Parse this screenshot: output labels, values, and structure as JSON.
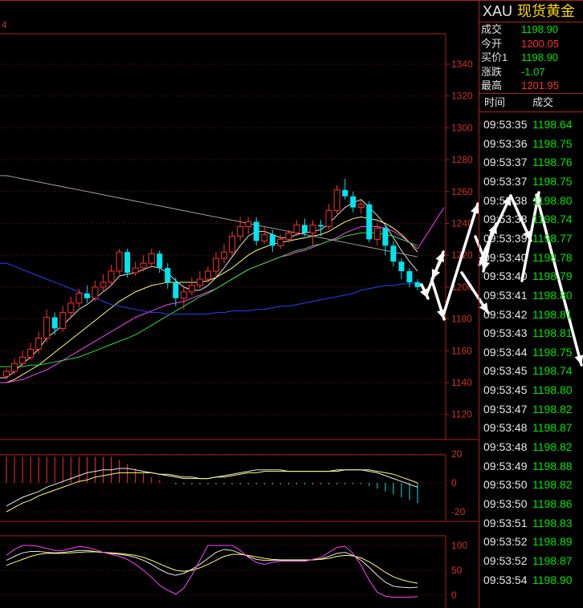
{
  "header": {
    "corner_label": "4"
  },
  "symbol": {
    "code": "XAU",
    "name": "现货黄金"
  },
  "quote": [
    {
      "label": "成交",
      "value": "1198.90",
      "color": "#00e600"
    },
    {
      "label": "今开",
      "value": "1200.05",
      "color": "#ff3030"
    },
    {
      "label": "买价1",
      "value": "1198.90",
      "color": "#00e600"
    },
    {
      "label": "涨跌",
      "value": "-1.07",
      "color": "#00e600"
    },
    {
      "label": "最高",
      "value": "1201.95",
      "color": "#ff3030"
    }
  ],
  "ticks_header": {
    "time": "时间",
    "price": "成交"
  },
  "ticks": [
    {
      "time": "09:53:35",
      "price": "1198.64"
    },
    {
      "time": "09:53:36",
      "price": "1198.75"
    },
    {
      "time": "09:53:37",
      "price": "1198.76"
    },
    {
      "time": "09:53:37",
      "price": "1198.75"
    },
    {
      "time": "09:53:38",
      "price": "1198.80"
    },
    {
      "time": "09:53:38",
      "price": "1198.74"
    },
    {
      "time": "09:53:39",
      "price": "1198.77"
    },
    {
      "time": "09:53:40",
      "price": "1198.78"
    },
    {
      "time": "09:53:40",
      "price": "1198.79"
    },
    {
      "time": "09:53:41",
      "price": "1198.80"
    },
    {
      "time": "09:53:42",
      "price": "1198.81"
    },
    {
      "time": "09:53:43",
      "price": "1198.81"
    },
    {
      "time": "09:53:44",
      "price": "1198.75"
    },
    {
      "time": "09:53:45",
      "price": "1198.74"
    },
    {
      "time": "09:53:45",
      "price": "1198.80"
    },
    {
      "time": "09:53:47",
      "price": "1198.82"
    },
    {
      "time": "09:53:48",
      "price": "1198.87"
    },
    {
      "time": "09:53:48",
      "price": "1198.82"
    },
    {
      "time": "09:53:49",
      "price": "1198.88"
    },
    {
      "time": "09:53:50",
      "price": "1198.82"
    },
    {
      "time": "09:53:50",
      "price": "1198.86"
    },
    {
      "time": "09:53:51",
      "price": "1198.83"
    },
    {
      "time": "09:53:52",
      "price": "1198.89"
    },
    {
      "time": "09:53:52",
      "price": "1198.87"
    },
    {
      "time": "09:53:54",
      "price": "1198.90"
    }
  ],
  "main_axis": {
    "ticks": [
      "1340",
      "1320",
      "1300",
      "1280",
      "1260",
      "1240",
      "1220",
      "1200",
      "1180",
      "1160",
      "1140",
      "1120"
    ],
    "min": 1110,
    "max": 1350
  },
  "macd_axis": {
    "ticks": [
      "20",
      "0",
      "-20"
    ]
  },
  "kdj_axis": {
    "ticks": [
      "100",
      "50",
      "0"
    ]
  },
  "chart_data": {
    "type": "candlestick",
    "ylim": [
      1110,
      1350
    ],
    "colors": {
      "up": "#ff3030",
      "down": "#00e5ee",
      "grid": "#7a1010"
    },
    "candles": [
      {
        "o": 1144,
        "c": 1147,
        "h": 1149,
        "l": 1142
      },
      {
        "o": 1147,
        "c": 1152,
        "h": 1155,
        "l": 1145
      },
      {
        "o": 1152,
        "c": 1156,
        "h": 1160,
        "l": 1150
      },
      {
        "o": 1156,
        "c": 1161,
        "h": 1165,
        "l": 1154
      },
      {
        "o": 1161,
        "c": 1168,
        "h": 1172,
        "l": 1158
      },
      {
        "o": 1168,
        "c": 1181,
        "h": 1186,
        "l": 1165
      },
      {
        "o": 1181,
        "c": 1174,
        "h": 1184,
        "l": 1170
      },
      {
        "o": 1174,
        "c": 1184,
        "h": 1188,
        "l": 1172
      },
      {
        "o": 1184,
        "c": 1190,
        "h": 1194,
        "l": 1181
      },
      {
        "o": 1190,
        "c": 1196,
        "h": 1199,
        "l": 1187
      },
      {
        "o": 1196,
        "c": 1193,
        "h": 1201,
        "l": 1190
      },
      {
        "o": 1193,
        "c": 1200,
        "h": 1204,
        "l": 1191
      },
      {
        "o": 1200,
        "c": 1203,
        "h": 1208,
        "l": 1197
      },
      {
        "o": 1203,
        "c": 1210,
        "h": 1214,
        "l": 1201
      },
      {
        "o": 1210,
        "c": 1222,
        "h": 1224,
        "l": 1208
      },
      {
        "o": 1222,
        "c": 1209,
        "h": 1224,
        "l": 1206
      },
      {
        "o": 1209,
        "c": 1212,
        "h": 1216,
        "l": 1207
      },
      {
        "o": 1212,
        "c": 1215,
        "h": 1220,
        "l": 1210
      },
      {
        "o": 1215,
        "c": 1221,
        "h": 1224,
        "l": 1212
      },
      {
        "o": 1221,
        "c": 1212,
        "h": 1223,
        "l": 1209
      },
      {
        "o": 1212,
        "c": 1203,
        "h": 1215,
        "l": 1199
      },
      {
        "o": 1203,
        "c": 1193,
        "h": 1206,
        "l": 1188
      },
      {
        "o": 1193,
        "c": 1197,
        "h": 1201,
        "l": 1186
      },
      {
        "o": 1197,
        "c": 1201,
        "h": 1206,
        "l": 1195
      },
      {
        "o": 1201,
        "c": 1205,
        "h": 1210,
        "l": 1199
      },
      {
        "o": 1205,
        "c": 1210,
        "h": 1213,
        "l": 1203
      },
      {
        "o": 1210,
        "c": 1218,
        "h": 1222,
        "l": 1207
      },
      {
        "o": 1218,
        "c": 1222,
        "h": 1227,
        "l": 1215
      },
      {
        "o": 1222,
        "c": 1232,
        "h": 1235,
        "l": 1220
      },
      {
        "o": 1232,
        "c": 1238,
        "h": 1244,
        "l": 1229
      },
      {
        "o": 1238,
        "c": 1241,
        "h": 1244,
        "l": 1233
      },
      {
        "o": 1241,
        "c": 1229,
        "h": 1244,
        "l": 1226
      },
      {
        "o": 1229,
        "c": 1233,
        "h": 1238,
        "l": 1227
      },
      {
        "o": 1233,
        "c": 1226,
        "h": 1236,
        "l": 1222
      },
      {
        "o": 1226,
        "c": 1230,
        "h": 1233,
        "l": 1224
      },
      {
        "o": 1230,
        "c": 1234,
        "h": 1236,
        "l": 1228
      },
      {
        "o": 1234,
        "c": 1239,
        "h": 1242,
        "l": 1232
      },
      {
        "o": 1239,
        "c": 1234,
        "h": 1243,
        "l": 1232
      },
      {
        "o": 1234,
        "c": 1239,
        "h": 1242,
        "l": 1226
      },
      {
        "o": 1239,
        "c": 1238,
        "h": 1242,
        "l": 1232
      },
      {
        "o": 1238,
        "c": 1248,
        "h": 1252,
        "l": 1236
      },
      {
        "o": 1248,
        "c": 1261,
        "h": 1264,
        "l": 1246
      },
      {
        "o": 1261,
        "c": 1257,
        "h": 1268,
        "l": 1255
      },
      {
        "o": 1257,
        "c": 1250,
        "h": 1260,
        "l": 1247
      },
      {
        "o": 1250,
        "c": 1252,
        "h": 1255,
        "l": 1246
      },
      {
        "o": 1252,
        "c": 1230,
        "h": 1254,
        "l": 1228
      },
      {
        "o": 1230,
        "c": 1237,
        "h": 1240,
        "l": 1226
      },
      {
        "o": 1237,
        "c": 1226,
        "h": 1239,
        "l": 1220
      },
      {
        "o": 1226,
        "c": 1216,
        "h": 1229,
        "l": 1213
      },
      {
        "o": 1216,
        "c": 1210,
        "h": 1218,
        "l": 1205
      },
      {
        "o": 1210,
        "c": 1203,
        "h": 1212,
        "l": 1200
      },
      {
        "o": 1203,
        "c": 1200,
        "h": 1205,
        "l": 1198
      }
    ],
    "ma_lines": [
      {
        "color": "#e0e0e0",
        "values": [
          1143,
          1147,
          1152,
          1156,
          1161,
          1168,
          1172,
          1176,
          1181,
          1186,
          1189,
          1193,
          1197,
          1201,
          1207,
          1208,
          1209,
          1211,
          1213,
          1212,
          1209,
          1204,
          1200,
          1198,
          1198,
          1201,
          1206,
          1212,
          1219,
          1226,
          1232,
          1235,
          1235,
          1233,
          1231,
          1231,
          1233,
          1234,
          1235,
          1236,
          1240,
          1245,
          1250,
          1253,
          1255,
          1250,
          1245,
          1239,
          1231,
          1223,
          1216,
          1210
        ]
      },
      {
        "color": "#ffff66",
        "values": [
          1140,
          1142,
          1145,
          1148,
          1151,
          1155,
          1159,
          1163,
          1167,
          1171,
          1175,
          1179,
          1183,
          1187,
          1191,
          1194,
          1197,
          1199,
          1201,
          1202,
          1203,
          1203,
          1203,
          1203,
          1203,
          1204,
          1206,
          1209,
          1212,
          1216,
          1220,
          1223,
          1225,
          1227,
          1228,
          1229,
          1230,
          1231,
          1232,
          1233,
          1235,
          1238,
          1241,
          1243,
          1244,
          1243,
          1242,
          1240,
          1237,
          1233,
          1228,
          1222
        ]
      },
      {
        "color": "#ff44ff",
        "values": [
          1140,
          1141,
          1142,
          1144,
          1146,
          1148,
          1151,
          1154,
          1157,
          1160,
          1163,
          1166,
          1169,
          1172,
          1175,
          1178,
          1181,
          1183,
          1185,
          1187,
          1189,
          1190,
          1191,
          1193,
          1195,
          1197,
          1199,
          1202,
          1205,
          1208,
          1211,
          1213,
          1215,
          1217,
          1219,
          1220,
          1222,
          1223,
          1225,
          1227,
          1229,
          1231,
          1234,
          1236,
          1238,
          1238,
          1238,
          1237,
          1235,
          1232,
          1228,
          1224
        ]
      },
      {
        "color": "#33dd33",
        "values": [
          1150,
          1150,
          1150,
          1151,
          1151,
          1152,
          1153,
          1154,
          1155,
          1156,
          1158,
          1160,
          1162,
          1164,
          1166,
          1168,
          1170,
          1173,
          1176,
          1179,
          1182,
          1185,
          1188,
          1191,
          1194,
          1196,
          1199,
          1202,
          1205,
          1208,
          1211,
          1213,
          1215,
          1217,
          1219,
          1221,
          1223,
          1224,
          1226,
          1227,
          1229,
          1230,
          1232,
          1233,
          1234,
          1234,
          1234,
          1233,
          1232,
          1230,
          1228,
          1226
        ]
      },
      {
        "color": "#2244ff",
        "values": [
          1215,
          1213,
          1211,
          1209,
          1207,
          1205,
          1203,
          1201,
          1199,
          1197,
          1195,
          1193,
          1191,
          1189,
          1188,
          1187,
          1186,
          1185,
          1184,
          1184,
          1183,
          1183,
          1183,
          1183,
          1183,
          1183,
          1184,
          1184,
          1185,
          1185,
          1185,
          1186,
          1186,
          1187,
          1188,
          1188,
          1189,
          1190,
          1191,
          1192,
          1193,
          1194,
          1195,
          1196,
          1198,
          1199,
          1200,
          1201,
          1201,
          1202,
          1202,
          1203
        ]
      },
      {
        "color": "#a0a0a0",
        "values": [
          1270,
          1269,
          1268,
          1267,
          1266,
          1265,
          1264,
          1263,
          1262,
          1261,
          1260,
          1259,
          1258,
          1257,
          1256,
          1255,
          1254,
          1253,
          1252,
          1251,
          1250,
          1249,
          1248,
          1247,
          1246,
          1245,
          1244,
          1243,
          1242,
          1241,
          1240,
          1239,
          1238,
          1237,
          1236,
          1235,
          1234,
          1233,
          1232,
          1231,
          1230,
          1229,
          1228,
          1227,
          1226,
          1225,
          1224,
          1223,
          1222,
          1221,
          1220,
          1219
        ]
      }
    ],
    "macd_hist": [
      18,
      18,
      18,
      18,
      18,
      18,
      18,
      18,
      18,
      18,
      18,
      18,
      18,
      18,
      16,
      13,
      10,
      7,
      4,
      2,
      0,
      -1,
      -1,
      -1,
      -1,
      -1,
      -1,
      -1,
      -1,
      -1,
      -1,
      -1,
      -1,
      -1,
      -1,
      -1,
      -1,
      -1,
      -1,
      -1,
      -1,
      -1,
      -1,
      -1,
      -1,
      -2,
      -4,
      -6,
      -8,
      -10,
      -12,
      -14
    ],
    "macd_dif": [
      -16,
      -13,
      -10,
      -8,
      -6,
      -3,
      -1,
      1,
      3,
      5,
      7,
      8,
      9,
      9,
      10,
      10,
      9,
      8,
      7,
      6,
      5,
      4,
      3,
      3,
      3,
      3,
      4,
      5,
      6,
      7,
      8,
      9,
      9,
      9,
      9,
      8,
      8,
      8,
      8,
      8,
      8,
      9,
      9,
      9,
      9,
      8,
      7,
      5,
      3,
      1,
      -1,
      -3
    ],
    "macd_dea": [
      -20,
      -17,
      -14,
      -12,
      -9,
      -7,
      -5,
      -3,
      -1,
      1,
      2,
      4,
      5,
      6,
      7,
      7,
      7,
      7,
      7,
      6,
      6,
      5,
      4,
      4,
      3,
      3,
      4,
      4,
      5,
      6,
      7,
      7,
      8,
      8,
      8,
      8,
      8,
      8,
      8,
      8,
      8,
      8,
      9,
      9,
      9,
      9,
      8,
      7,
      6,
      4,
      2,
      0
    ],
    "kdj_k": [
      70,
      78,
      85,
      88,
      88,
      86,
      85,
      86,
      88,
      90,
      90,
      88,
      86,
      84,
      82,
      80,
      76,
      70,
      62,
      52,
      44,
      40,
      44,
      52,
      62,
      74,
      86,
      92,
      90,
      84,
      78,
      72,
      70,
      70,
      70,
      70,
      70,
      70,
      71,
      73,
      78,
      84,
      86,
      80,
      70,
      56,
      40,
      26,
      18,
      16,
      15,
      16
    ],
    "kdj_d": [
      60,
      66,
      72,
      78,
      82,
      84,
      84,
      84,
      85,
      86,
      87,
      87,
      86,
      85,
      84,
      82,
      80,
      76,
      70,
      63,
      56,
      50,
      48,
      50,
      55,
      62,
      70,
      78,
      82,
      82,
      80,
      77,
      74,
      72,
      71,
      71,
      71,
      71,
      71,
      72,
      74,
      78,
      80,
      79,
      75,
      67,
      57,
      46,
      37,
      31,
      27,
      24
    ],
    "kdj_j": [
      80,
      92,
      100,
      100,
      98,
      94,
      90,
      90,
      94,
      98,
      96,
      92,
      86,
      82,
      78,
      72,
      62,
      50,
      36,
      20,
      10,
      2,
      14,
      40,
      70,
      100,
      100,
      100,
      100,
      90,
      76,
      66,
      62,
      66,
      68,
      68,
      68,
      68,
      72,
      76,
      86,
      96,
      98,
      84,
      60,
      30,
      6,
      -2,
      -4,
      -4,
      -4,
      -3
    ]
  }
}
